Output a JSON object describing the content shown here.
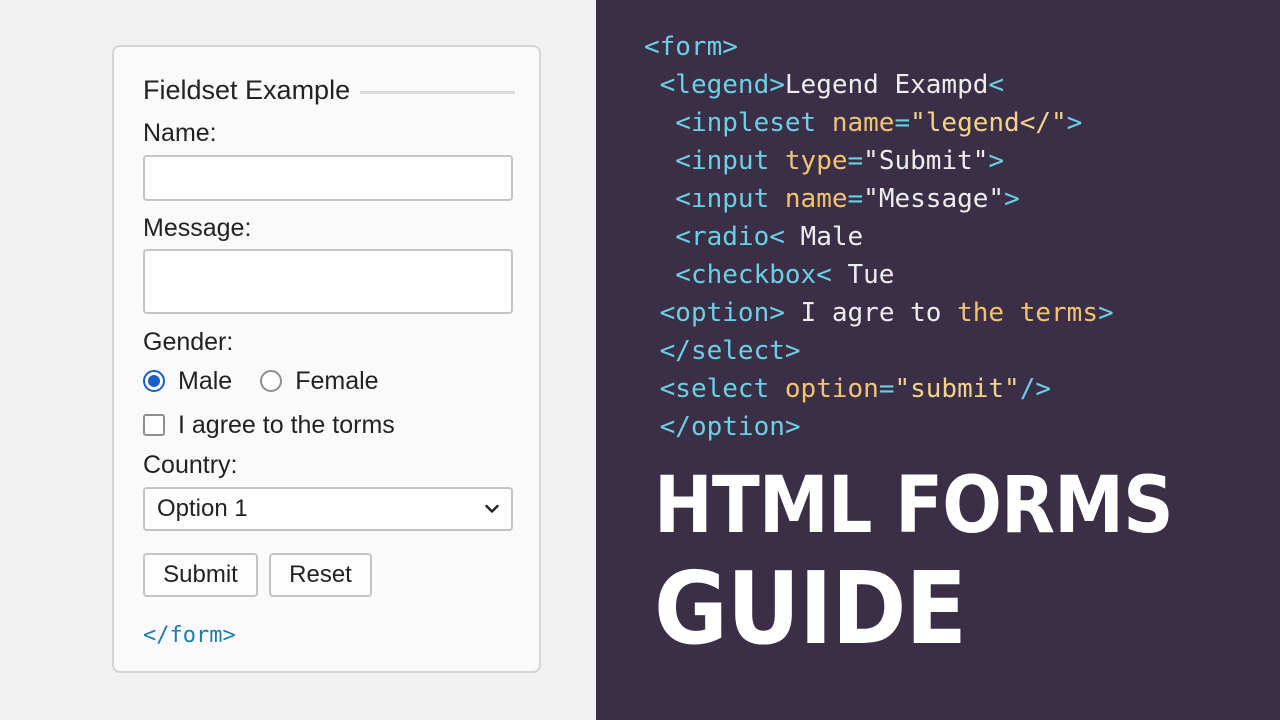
{
  "form_preview": {
    "legend": "Fieldset Example",
    "name_label": "Name:",
    "name_value": "",
    "message_label": "Message:",
    "message_value": "",
    "gender_label": "Gender:",
    "gender_options": [
      "Male",
      "Female"
    ],
    "gender_selected": "Male",
    "agree_label": "I agree to the torms",
    "agree_checked": false,
    "country_label": "Country:",
    "country_selected": "Option 1",
    "submit_label": "Submit",
    "reset_label": "Reset",
    "closing_tag": "</form>"
  },
  "code_snippet": {
    "lines": [
      [
        {
          "t": "tag",
          "s": "<form>"
        }
      ],
      [
        {
          "t": "tag",
          "s": " <legend>"
        },
        {
          "t": "txt",
          "s": "Legend Exampd"
        },
        {
          "t": "tag",
          "s": "<"
        }
      ],
      [
        {
          "t": "tag",
          "s": "  <inpleset "
        },
        {
          "t": "attr",
          "s": "name"
        },
        {
          "t": "tag",
          "s": "="
        },
        {
          "t": "str",
          "s": "\"legend</\""
        },
        {
          "t": "tag",
          "s": ">"
        }
      ],
      [
        {
          "t": "tag",
          "s": "  <input "
        },
        {
          "t": "attr",
          "s": "type"
        },
        {
          "t": "tag",
          "s": "="
        },
        {
          "t": "txt",
          "s": "\"Submit\""
        },
        {
          "t": "tag",
          "s": ">"
        }
      ],
      [
        {
          "t": "tag",
          "s": "  <ınput "
        },
        {
          "t": "attr",
          "s": "name"
        },
        {
          "t": "tag",
          "s": "="
        },
        {
          "t": "txt",
          "s": "\"Message\""
        },
        {
          "t": "tag",
          "s": ">"
        }
      ],
      [
        {
          "t": "tag",
          "s": "  <radio< "
        },
        {
          "t": "txt",
          "s": "Male"
        }
      ],
      [
        {
          "t": "tag",
          "s": "  <checkbox< "
        },
        {
          "t": "txt",
          "s": "Tue"
        }
      ],
      [
        {
          "t": "tag",
          "s": " <option> "
        },
        {
          "t": "txt",
          "s": "I agre to "
        },
        {
          "t": "attr",
          "s": "the terms"
        },
        {
          "t": "tag",
          "s": ">"
        }
      ],
      [
        {
          "t": "tag",
          "s": " </select>"
        }
      ],
      [
        {
          "t": "tag",
          "s": " <select "
        },
        {
          "t": "attr",
          "s": "option"
        },
        {
          "t": "tag",
          "s": "="
        },
        {
          "t": "str",
          "s": "\"submit\""
        },
        {
          "t": "tag",
          "s": "/>"
        }
      ],
      [
        {
          "t": "tag",
          "s": " </option>"
        }
      ]
    ]
  },
  "title": {
    "line1": "HTML FORMS",
    "line2": "GUIDE"
  },
  "colors": {
    "right_background": "#3a2f47",
    "tag": "#6bd0e3",
    "attribute": "#f2c46f",
    "radio_accent": "#1a5fc4",
    "closing_tag": "#1f7cab"
  }
}
